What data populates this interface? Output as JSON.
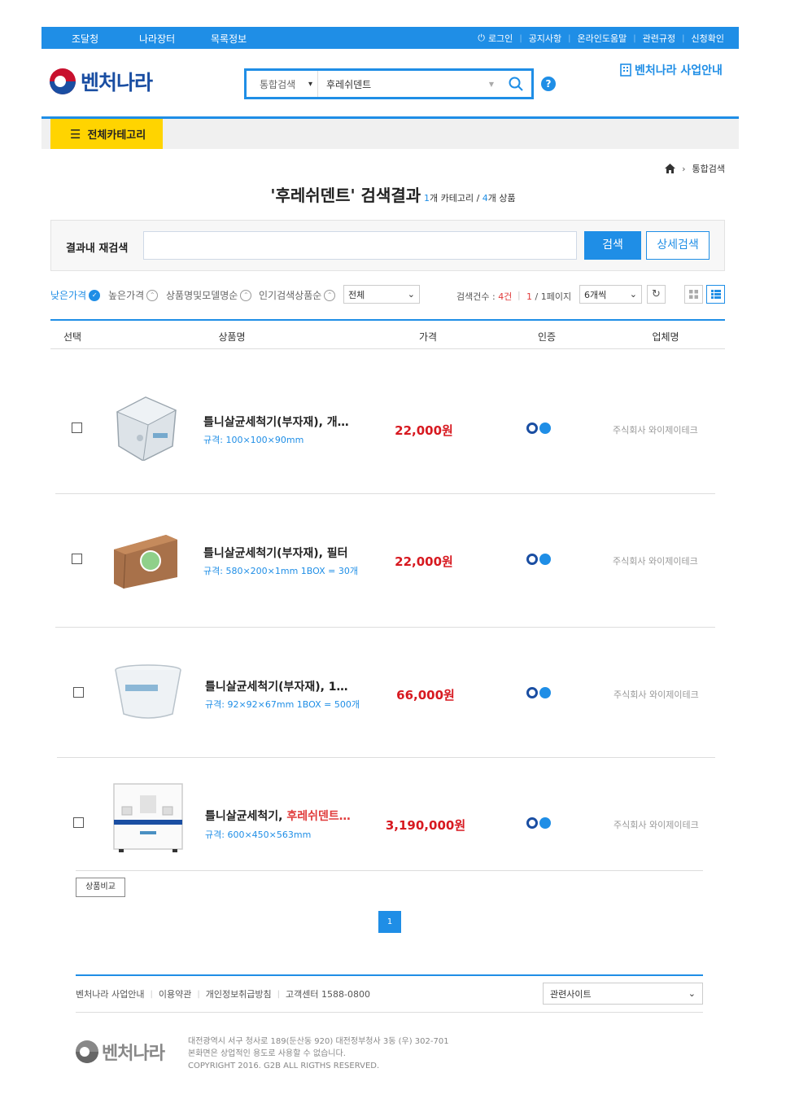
{
  "topbar": {
    "nav": [
      "조달청",
      "나라장터",
      "목록정보"
    ],
    "util": [
      "로그인",
      "공지사항",
      "온라인도움말",
      "관련규정",
      "신청확인"
    ]
  },
  "header": {
    "logo": "벤처나라",
    "search_scope": "통합검색",
    "search_query": "후레쉬덴트",
    "help": "?",
    "biz_link": "벤처나라 사업안내"
  },
  "category_button": "전체카테고리",
  "breadcrumb": [
    "통합검색"
  ],
  "result_title": {
    "main": "'후레쉬덴트' 검색결과",
    "cat_count": "1",
    "cat_label": "개 카테고리 / ",
    "prod_count": "4",
    "prod_label": "개 상품"
  },
  "refine": {
    "label": "결과내 재검색",
    "search_btn": "검색",
    "detail_btn": "상세검색"
  },
  "sort": {
    "options": [
      "낮은가격",
      "높은가격",
      "상품명및모델명순",
      "인기검색상품순"
    ],
    "active": 0,
    "filter": "전체",
    "count_label": "검색건수 : ",
    "count": "4건",
    "page_cur": "1",
    "page_rest": " / 1페이지",
    "per_page": "6개씩"
  },
  "table": {
    "headers": [
      "선택",
      "상품명",
      "가격",
      "인증",
      "업체명"
    ],
    "rows": [
      {
        "name": "틀니살균세척기(부자재), 개…",
        "name_hl": "",
        "spec": "규격: 100×100×90mm",
        "price": "22,000원",
        "vendor": "주식회사 와이제이테크"
      },
      {
        "name": "틀니살균세척기(부자재), 필터",
        "name_hl": "",
        "spec": "규격: 580×200×1mm 1BOX = 30개",
        "price": "22,000원",
        "vendor": "주식회사 와이제이테크"
      },
      {
        "name": "틀니살균세척기(부자재), 1…",
        "name_hl": "",
        "spec": "규격: 92×92×67mm 1BOX = 500개",
        "price": "66,000원",
        "vendor": "주식회사 와이제이테크"
      },
      {
        "name": "틀니살균세척기, ",
        "name_hl": "후레쉬덴트…",
        "spec": "규격: 600×450×563mm",
        "price": "3,190,000원",
        "vendor": "주식회사 와이제이테크"
      }
    ]
  },
  "compare_btn": "상품비교",
  "pagination": [
    "1"
  ],
  "footer": {
    "links": [
      "벤처나라 사업안내",
      "이용약관",
      "개인정보취급방침",
      "고객센터 1588-0800"
    ],
    "related": "관련사이트",
    "logo": "벤처나라",
    "address": "대전광역시 서구 청사로 189(둔산동 920) 대전정부청사 3동 (우) 302-701",
    "notice": "본화면은 상업적인 용도로 사용할 수 없습니다.",
    "copyright": "COPYRIGHT 2016. G2B ALL RIGTHS RESERVED."
  },
  "colors": {
    "primary": "#1f8ee6",
    "accent_yellow": "#ffd400",
    "price_red": "#d71920"
  }
}
